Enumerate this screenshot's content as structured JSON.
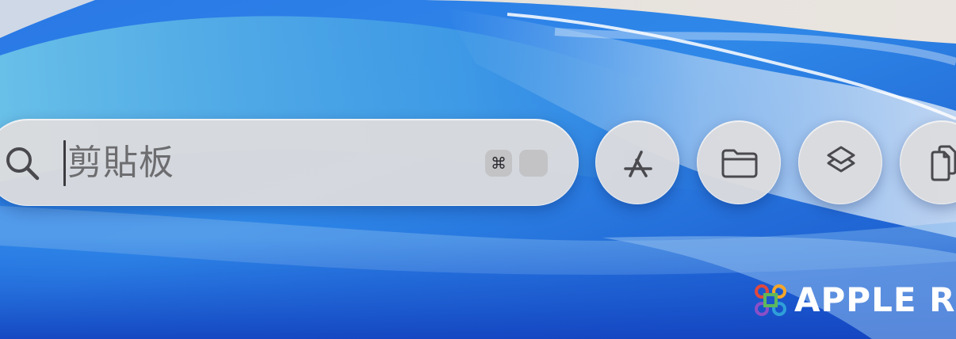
{
  "spotlight": {
    "query": "剪貼板",
    "shortcut_key": "⌘",
    "search_icon": "magnifying-glass-icon"
  },
  "mode_buttons": [
    {
      "id": "applications",
      "icon": "app-store-icon"
    },
    {
      "id": "files",
      "icon": "folder-icon"
    },
    {
      "id": "shortcuts",
      "icon": "shortcuts-icon"
    },
    {
      "id": "clipboard",
      "icon": "clipboard-icon"
    }
  ],
  "watermark": {
    "text": "APPLE R",
    "logo": "command-key-logo"
  },
  "colors": {
    "wallpaper_primary": "#1f63d8",
    "bar_background": "#dcdcde",
    "icon_color": "#4a4a4e"
  }
}
